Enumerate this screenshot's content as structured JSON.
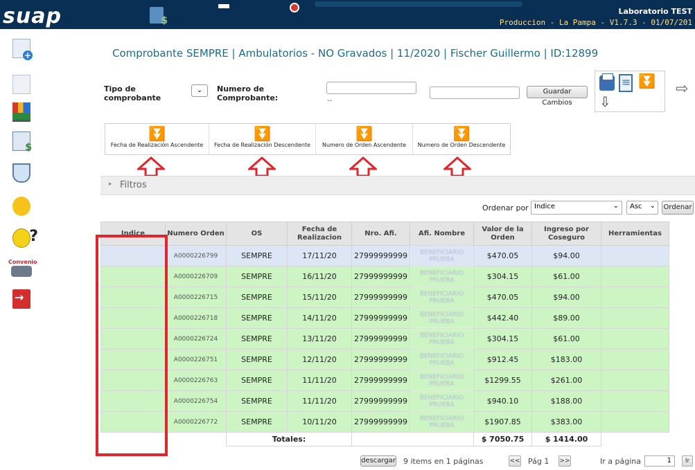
{
  "header": {
    "logo": "suap",
    "lab": "Laboratorio TEST",
    "env": "Produccion - La Pampa - V1.7.3 - 01/07/201"
  },
  "sidebar": {
    "items": [
      {
        "name": "new-document-icon"
      },
      {
        "name": "document-icon"
      },
      {
        "name": "chart-icon"
      },
      {
        "name": "invoice-icon"
      },
      {
        "name": "lab-icon"
      },
      {
        "name": "chat-icon"
      },
      {
        "name": "help-icon"
      },
      {
        "name": "convenio-icon",
        "label": "Convenio"
      },
      {
        "name": "exit-icon"
      }
    ]
  },
  "title": "Comprobante SEMPRE | Ambulatorios - NO Gravados | 11/2020 | Fischer Guillermo | ID:12899",
  "form": {
    "tipo_label_1": "Tipo de",
    "tipo_label_2": "comprobante",
    "numero_label_1": "Numero de",
    "numero_label_2": "Comprobante:",
    "numero_value": "",
    "numero_hint": "--",
    "extra_value": "",
    "save_label": "Guardar Cambios"
  },
  "sort_buttons": [
    "Fecha de Realización Ascendente",
    "Fecha de Realización Descendente",
    "Numero de Orden Ascendente",
    "Numero de Orden Descendente"
  ],
  "filtros": {
    "label": "Filtros"
  },
  "ordenar": {
    "label": "Ordenar por",
    "field": "Indice",
    "dir": "Asc",
    "button": "Ordenar"
  },
  "table": {
    "headers": [
      "Indice",
      "Numero Orden",
      "OS",
      "Fecha de Realizacion",
      "Nro. Afi.",
      "Afi. Nombre",
      "Valor de la Orden",
      "Ingreso por Coseguro",
      "Herramientas"
    ],
    "rows": [
      {
        "indice": "",
        "orden": "A0000226799",
        "os": "SEMPRE",
        "fecha": "17/11/20",
        "afi": "27999999999",
        "nombre": "BENEFICIARIO PRUEBA",
        "valor": "$470.05",
        "coseguro": "$94.00",
        "herr": ""
      },
      {
        "indice": "",
        "orden": "A0000226709",
        "os": "SEMPRE",
        "fecha": "16/11/20",
        "afi": "27999999999",
        "nombre": "BENEFICIARIO PRUEBA",
        "valor": "$304.15",
        "coseguro": "$61.00",
        "herr": ""
      },
      {
        "indice": "",
        "orden": "A0000226715",
        "os": "SEMPRE",
        "fecha": "15/11/20",
        "afi": "27999999999",
        "nombre": "BENEFICIARIO PRUEBA",
        "valor": "$470.05",
        "coseguro": "$94.00",
        "herr": ""
      },
      {
        "indice": "",
        "orden": "A0000226718",
        "os": "SEMPRE",
        "fecha": "14/11/20",
        "afi": "27999999999",
        "nombre": "BENEFICIARIO PRUEBA",
        "valor": "$442.40",
        "coseguro": "$89.00",
        "herr": ""
      },
      {
        "indice": "",
        "orden": "A0000226724",
        "os": "SEMPRE",
        "fecha": "13/11/20",
        "afi": "27999999999",
        "nombre": "BENEFICIARIO PRUEBA",
        "valor": "$304.15",
        "coseguro": "$61.00",
        "herr": ""
      },
      {
        "indice": "",
        "orden": "A0000226751",
        "os": "SEMPRE",
        "fecha": "12/11/20",
        "afi": "27999999999",
        "nombre": "BENEFICIARIO PRUEBA",
        "valor": "$912.45",
        "coseguro": "$183.00",
        "herr": ""
      },
      {
        "indice": "",
        "orden": "A0000226763",
        "os": "SEMPRE",
        "fecha": "11/11/20",
        "afi": "27999999999",
        "nombre": "BENEFICIARIO PRUEBA",
        "valor": "$1299.55",
        "coseguro": "$261.00",
        "herr": ""
      },
      {
        "indice": "",
        "orden": "A0000226754",
        "os": "SEMPRE",
        "fecha": "11/11/20",
        "afi": "27999999999",
        "nombre": "BENEFICIARIO PRUEBA",
        "valor": "$940.10",
        "coseguro": "$188.00",
        "herr": ""
      },
      {
        "indice": "",
        "orden": "A0000226772",
        "os": "SEMPRE",
        "fecha": "10/11/20",
        "afi": "27999999999",
        "nombre": "BENEFICIARIO PRUEBA",
        "valor": "$1907.85",
        "coseguro": "$383.00",
        "herr": ""
      }
    ],
    "totals_label": "Totales:",
    "total_valor": "$ 7050.75",
    "total_coseguro": "$ 1414.00"
  },
  "pagination": {
    "download": "descargar",
    "summary": "9 items en 1 páginas",
    "prev": "<<",
    "page": "Pág 1",
    "next": ">>",
    "goto_label": "Ir a página",
    "goto_value": "1",
    "goto_button": "Ir"
  },
  "colors": {
    "header_bg": "#0a2f55",
    "row_green": "#ccf5c3",
    "row_selected": "#dde6f5",
    "highlight_red": "#e0262c",
    "title_blue": "#1c6c8c"
  }
}
